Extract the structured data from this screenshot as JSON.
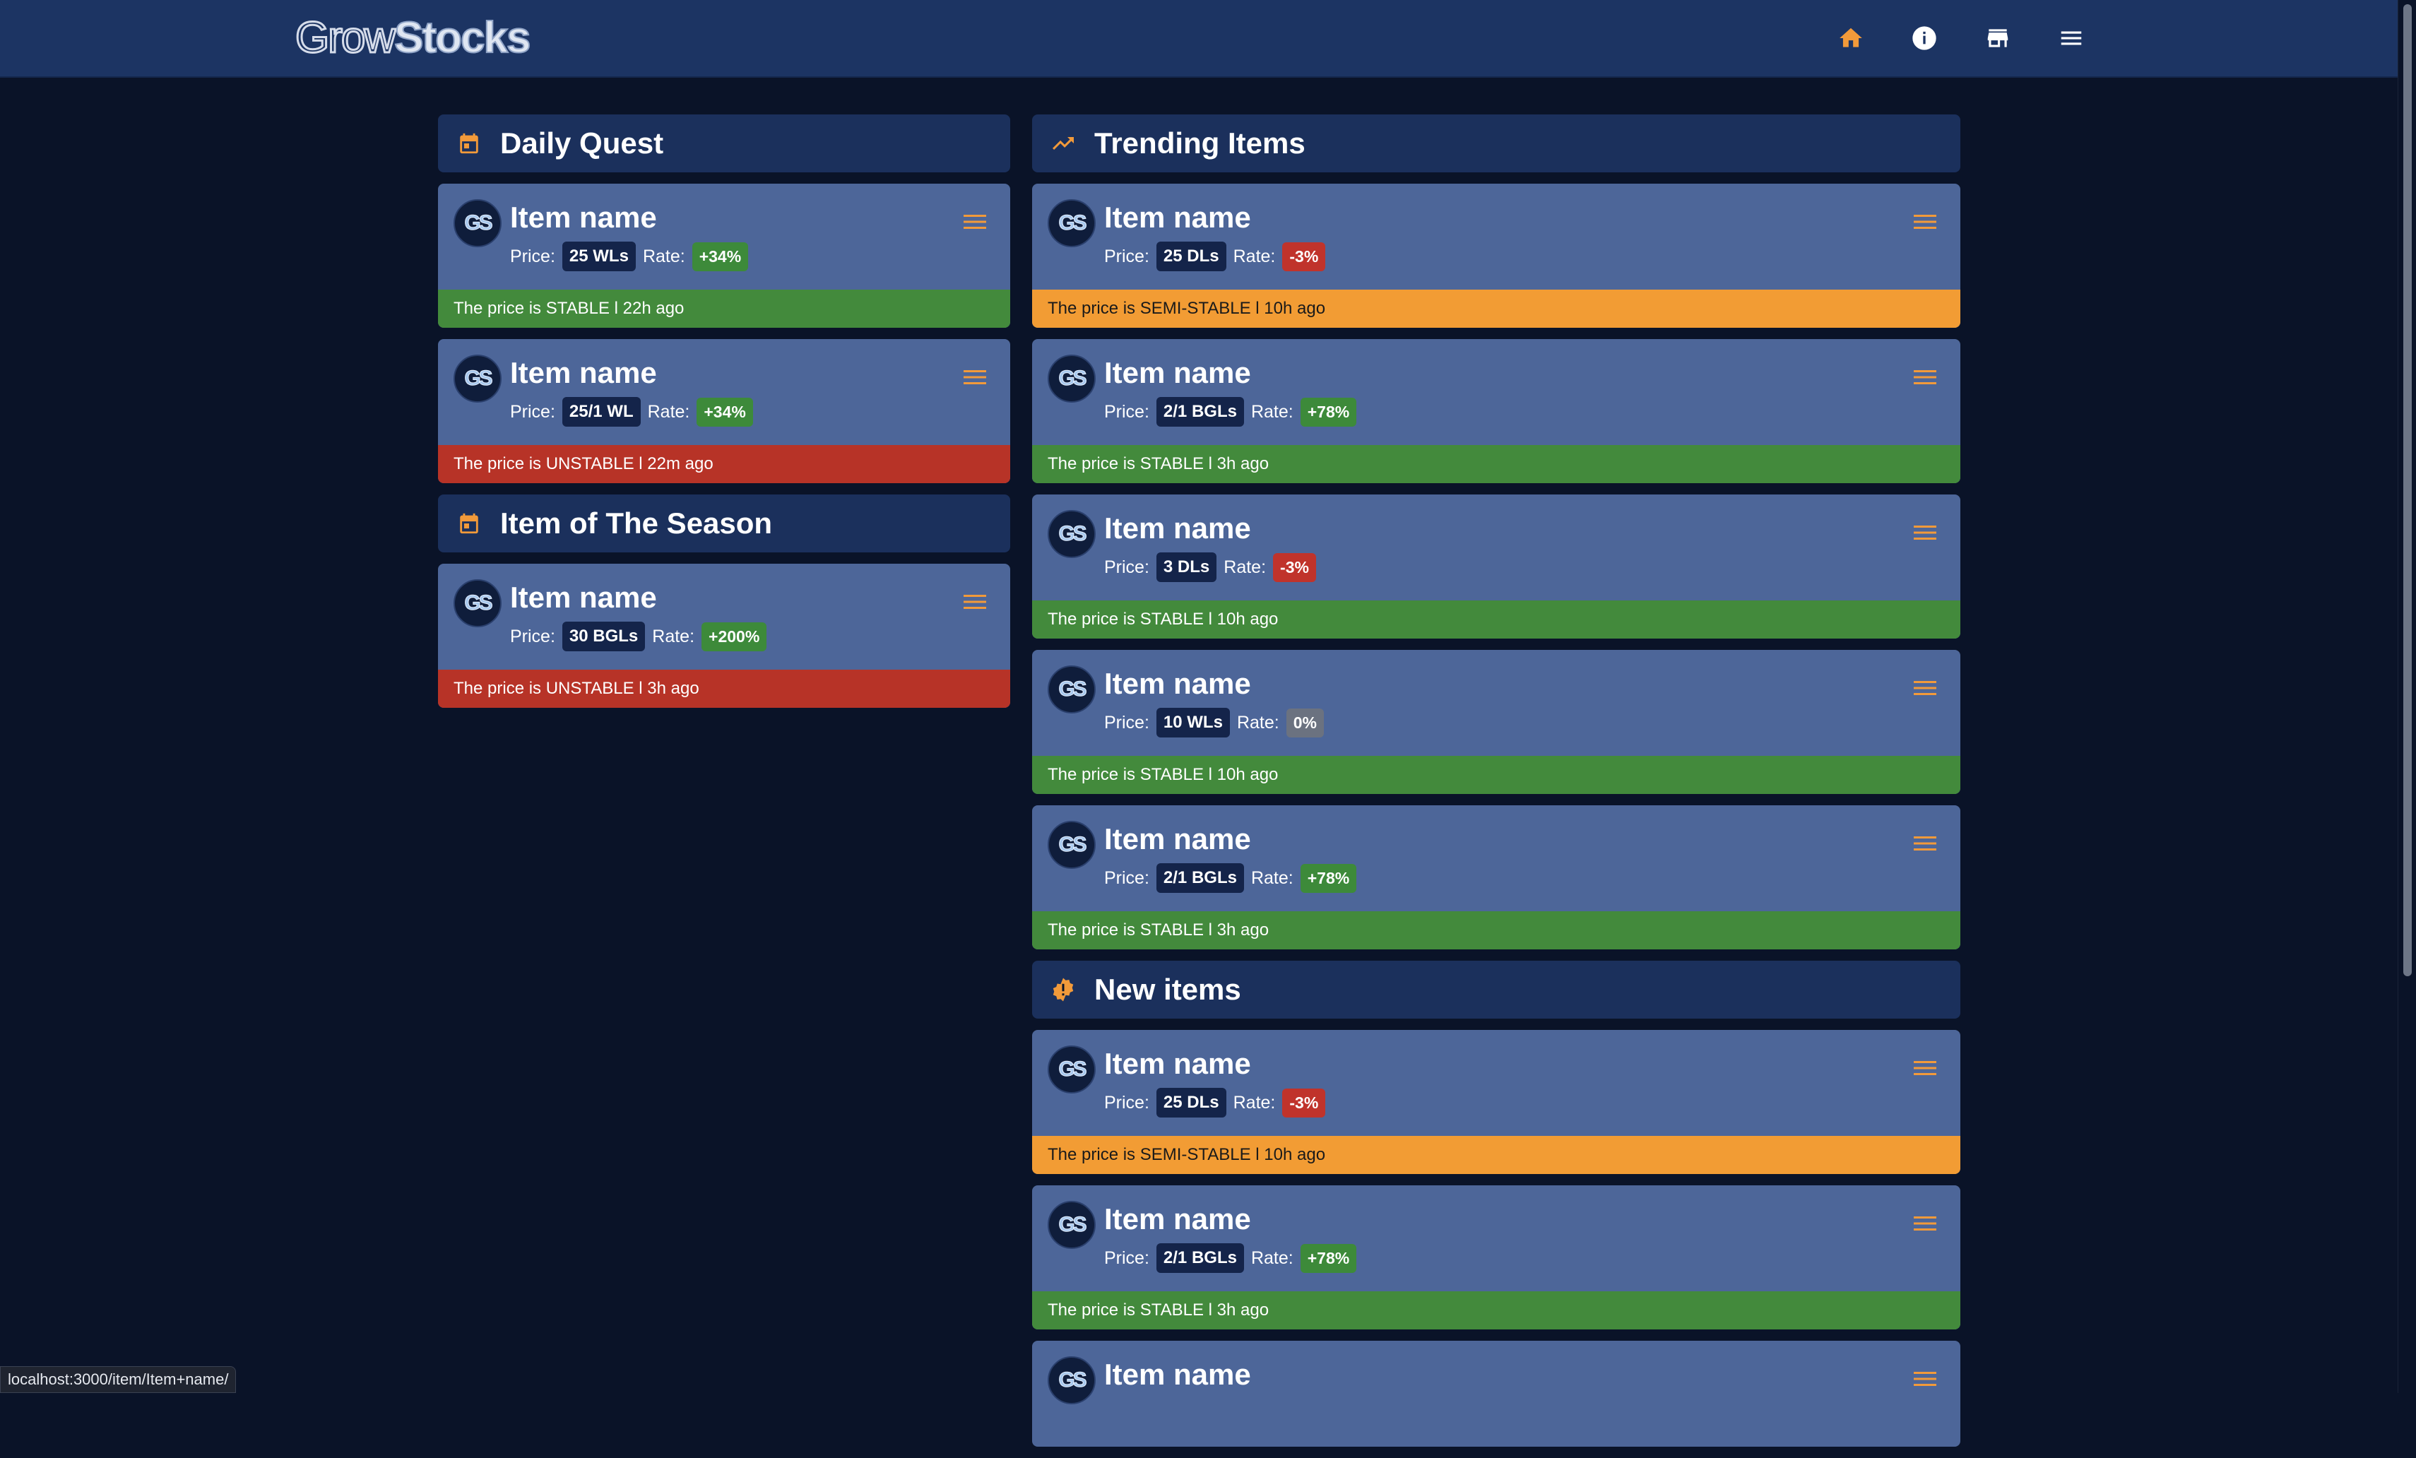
{
  "app": {
    "logo_light": "Grow",
    "logo_bold": "Stocks",
    "nav": [
      {
        "name": "home-icon",
        "color": "#f29a3a"
      },
      {
        "name": "info-icon",
        "color": "#ffffff"
      },
      {
        "name": "store-icon",
        "color": "#ffffff"
      },
      {
        "name": "menu-icon",
        "color": "#ffffff"
      }
    ]
  },
  "colors": {
    "positive": "#3d8a3a",
    "negative": "#c0332b",
    "neutral": "#6b7280",
    "stable": "#438a3c",
    "unstable": "#b73327",
    "semi_stable": "#f29c34",
    "accent": "#f29a3a"
  },
  "labels": {
    "price": "Price:",
    "rate": "Rate:",
    "avatar": "GS"
  },
  "sections": {
    "daily_quest": {
      "title": "Daily Quest",
      "icon": "calendar-icon",
      "items": [
        {
          "name": "Item name",
          "price": "25 WLs",
          "rate": "+34%",
          "rate_kind": "positive",
          "status": "The price is STABLE l 22h ago",
          "status_kind": "stable"
        },
        {
          "name": "Item name",
          "price": "25/1 WL",
          "rate": "+34%",
          "rate_kind": "positive",
          "status": "The price is UNSTABLE l 22m ago",
          "status_kind": "unstable"
        }
      ]
    },
    "season": {
      "title": "Item of The Season",
      "icon": "calendar-icon",
      "items": [
        {
          "name": "Item name",
          "price": "30 BGLs",
          "rate": "+200%",
          "rate_kind": "positive",
          "status": "The price is UNSTABLE l 3h ago",
          "status_kind": "unstable"
        }
      ]
    },
    "trending": {
      "title": "Trending Items",
      "icon": "trending-up-icon",
      "items": [
        {
          "name": "Item name",
          "price": "25 DLs",
          "rate": "-3%",
          "rate_kind": "negative",
          "status": "The price is SEMI-STABLE l 10h ago",
          "status_kind": "semi_stable"
        },
        {
          "name": "Item name",
          "price": "2/1 BGLs",
          "rate": "+78%",
          "rate_kind": "positive",
          "status": "The price is STABLE l 3h ago",
          "status_kind": "stable"
        },
        {
          "name": "Item name",
          "price": "3 DLs",
          "rate": "-3%",
          "rate_kind": "negative",
          "status": "The price is STABLE l 10h ago",
          "status_kind": "stable"
        },
        {
          "name": "Item name",
          "price": "10 WLs",
          "rate": "0%",
          "rate_kind": "neutral",
          "status": "The price is STABLE l 10h ago",
          "status_kind": "stable"
        },
        {
          "name": "Item name",
          "price": "2/1 BGLs",
          "rate": "+78%",
          "rate_kind": "positive",
          "status": "The price is STABLE l 3h ago",
          "status_kind": "stable"
        }
      ]
    },
    "new_items": {
      "title": "New items",
      "icon": "alert-badge-icon",
      "items": [
        {
          "name": "Item name",
          "price": "25 DLs",
          "rate": "-3%",
          "rate_kind": "negative",
          "status": "The price is SEMI-STABLE l 10h ago",
          "status_kind": "semi_stable"
        },
        {
          "name": "Item name",
          "price": "2/1 BGLs",
          "rate": "+78%",
          "rate_kind": "positive",
          "status": "The price is STABLE l 3h ago",
          "status_kind": "stable"
        },
        {
          "name": "Item name",
          "price": "",
          "rate": "",
          "rate_kind": "positive",
          "status": "",
          "status_kind": "stable"
        }
      ]
    }
  },
  "status_url": "localhost:3000/item/Item+name/"
}
